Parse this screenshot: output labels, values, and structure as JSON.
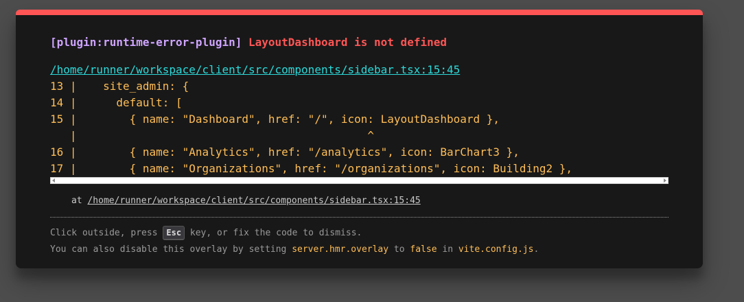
{
  "overlay": {
    "plugin_tag": "[plugin:runtime-error-plugin]",
    "message": "LayoutDashboard is not defined",
    "file_link": "/home/runner/workspace/client/src/components/sidebar.tsx:15:45",
    "code_frame": [
      "13 |    site_admin: {",
      "14 |      default: [",
      "15 |        { name: \"Dashboard\", href: \"/\", icon: LayoutDashboard },",
      "   |                                            ^",
      "16 |        { name: \"Analytics\", href: \"/analytics\", icon: BarChart3 },",
      "17 |        { name: \"Organizations\", href: \"/organizations\", icon: Building2 },"
    ],
    "stack_prefix": "at ",
    "stack_link": "/home/runner/workspace/client/src/components/sidebar.tsx:15:45",
    "tip_line1_a": "Click outside, press ",
    "tip_key": "Esc",
    "tip_line1_b": " key, or fix the code to dismiss.",
    "tip_line2_a": "You can also disable this overlay by setting ",
    "tip_code1": "server.hmr.overlay",
    "tip_line2_b": " to ",
    "tip_code2": "false",
    "tip_line2_c": " in ",
    "tip_code3": "vite.config.js",
    "tip_line2_d": "."
  },
  "colors": {
    "accent_border": "#ff5555",
    "plugin": "#cfa4ff",
    "error": "#ff5555",
    "link": "#2dd9da",
    "code": "#ffbe57"
  }
}
